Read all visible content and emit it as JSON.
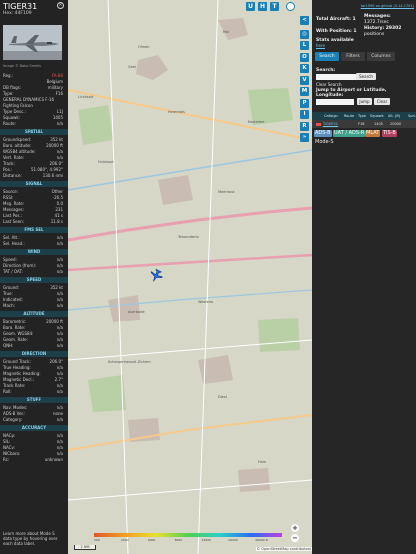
{
  "info": {
    "callsign": "TIGER31",
    "hex": "Hex: 44F109",
    "close_icon": "×",
    "photo_caption": "Image © Babz Smells",
    "rows1": [
      {
        "k": "Reg.:",
        "v": "FA-88",
        "red": true
      },
      {
        "k": "",
        "v": "Belgium"
      },
      {
        "k": "DB flags:",
        "v": "military"
      },
      {
        "k": "Type:",
        "v": "F16"
      },
      {
        "k": "GENERAL DYNAMICS F-16",
        "v": ""
      },
      {
        "k": "Fighting Falcon",
        "v": ""
      },
      {
        "k": "Type Desc.:",
        "v": "L1J"
      },
      {
        "k": "Squawk:",
        "v": "1405"
      },
      {
        "k": "Route:",
        "v": "n/a"
      }
    ],
    "sec_spatial": "SPATIAL",
    "rows_spatial": [
      {
        "k": "Groundspeed:",
        "v": "352 kt"
      },
      {
        "k": "Baro. altitude:",
        "v": "20000 ft"
      },
      {
        "k": "WGS84 altitude:",
        "v": "n/a"
      },
      {
        "k": "Vert. Rate:",
        "v": "n/a"
      },
      {
        "k": "Track:",
        "v": "206.0°"
      },
      {
        "k": "Pos.:",
        "v": "51.080°, 4.992°"
      },
      {
        "k": "Distance:",
        "v": "130.6 nmi"
      }
    ],
    "sec_signal": "SIGNAL",
    "rows_signal": [
      {
        "k": "Source:",
        "v": "Other"
      },
      {
        "k": "RSSI:",
        "v": "-26.5"
      },
      {
        "k": "Msg. Rate:",
        "v": "0.0"
      },
      {
        "k": "Messages:",
        "v": "231"
      },
      {
        "k": "Last Pos.:",
        "v": "41 s"
      },
      {
        "k": "Last Seen:",
        "v": "11.8 s"
      }
    ],
    "sec_fms": "FMS SEL",
    "rows_fms": [
      {
        "k": "Sel. Alt.:",
        "v": "n/a"
      },
      {
        "k": "Sel. Head.:",
        "v": "n/a"
      }
    ],
    "sec_wind": "WIND",
    "rows_wind": [
      {
        "k": "Speed:",
        "v": "n/a"
      },
      {
        "k": "Direction (from):",
        "v": "n/a"
      },
      {
        "k": "TAT / OAT:",
        "v": "n/a"
      }
    ],
    "sec_speed": "SPEED",
    "rows_speed": [
      {
        "k": "Ground:",
        "v": "352 kt"
      },
      {
        "k": "True:",
        "v": "n/a"
      },
      {
        "k": "Indicated:",
        "v": "n/a"
      },
      {
        "k": "Mach:",
        "v": "n/a"
      }
    ],
    "sec_altitude": "ALTITUDE",
    "rows_altitude": [
      {
        "k": "Barometric:",
        "v": "20000 ft"
      },
      {
        "k": "Baro. Rate:",
        "v": "n/a"
      },
      {
        "k": "Geom. WGS84:",
        "v": "n/a"
      },
      {
        "k": "Geom. Rate:",
        "v": "n/a"
      },
      {
        "k": "QNH:",
        "v": "n/a"
      }
    ],
    "sec_direction": "DIRECTION",
    "rows_direction": [
      {
        "k": "Ground Track:",
        "v": "206.0°"
      },
      {
        "k": "True Heading:",
        "v": "n/a"
      },
      {
        "k": "Magnetic Heading:",
        "v": "n/a"
      },
      {
        "k": "Magnetic Decl.:",
        "v": "2.7°"
      },
      {
        "k": "Track Rate:",
        "v": "n/a"
      },
      {
        "k": "Roll:",
        "v": "n/a"
      }
    ],
    "sec_stuff": "STUFF",
    "rows_stuff": [
      {
        "k": "Nav. Modes:",
        "v": "n/a"
      },
      {
        "k": "ADS-B Ver.:",
        "v": "none"
      },
      {
        "k": "Category:",
        "v": "n/a"
      }
    ],
    "sec_accuracy": "ACCURACY",
    "rows_accuracy": [
      {
        "k": "NACp:",
        "v": "n/a"
      },
      {
        "k": "SIL:",
        "v": "n/a"
      },
      {
        "k": "NACv:",
        "v": "n/a"
      },
      {
        "k": "NICbaro:",
        "v": "n/a"
      },
      {
        "k": "Rc:",
        "v": "unknown"
      }
    ],
    "footer": [
      "Learn more about Mode S",
      "data type by hovering over",
      "each data label."
    ]
  },
  "map": {
    "top_buttons": [
      "U",
      "H",
      "T"
    ],
    "zoom_in": "+",
    "zoom_out": "−",
    "scale": "2 NM",
    "alt_labels": [
      "500",
      "2000",
      "4000",
      "8000",
      "13000",
      "20000",
      "40000 ft"
    ],
    "alt_colors": [
      "#e3572a",
      "#f0a020",
      "#e8e030",
      "#4fd04f",
      "#2ad0c8",
      "#2a6ef0",
      "#c040e0"
    ],
    "attribution": "© OpenStreetMap contributors",
    "places": [
      "Mol",
      "Olmen",
      "Geel",
      "Hulshout",
      "Meerhout",
      "Tessenderlo",
      "Averbode",
      "Scherpenheuvel-Zichem",
      "Diest",
      "Kasterlee",
      "Lichtaart",
      "Herentals",
      "Westerlo",
      "Ham"
    ]
  },
  "btnbar": [
    "<",
    "◎",
    "L",
    "O",
    "K",
    "V",
    "M",
    "P",
    "I",
    "R",
    "»"
  ],
  "sidebar": {
    "link": "tar1090 on github (3.14.1701)",
    "total_label": "Total Aircraft: 1",
    "messages_label": "Messages:",
    "messages_value": "1372.7/sec",
    "position_label": "With Position: 1",
    "history_label": "History: 29302",
    "history_value": "positions",
    "stats_label": "Stats available",
    "stats_link": "here",
    "tabs": [
      "Search",
      "Filters",
      "Columns"
    ],
    "search_label": "Search:",
    "search_button": "Search",
    "clear_search": "Clear Search",
    "jump_label": "Jump to Airport or Latitude, Longitude:",
    "jump_button": "Jump",
    "clear_button": "Clear",
    "table_headers": [
      "Callsign",
      "Route",
      "Type",
      "Squawk",
      "Alt. (ft)",
      "Spd."
    ],
    "table_row": [
      "TIGER31",
      "F16",
      "1405",
      "20000"
    ],
    "tags": [
      "ADS-B",
      "UAT / ADS-R",
      "MLAT",
      "TIS-B",
      "Mode-S"
    ]
  }
}
